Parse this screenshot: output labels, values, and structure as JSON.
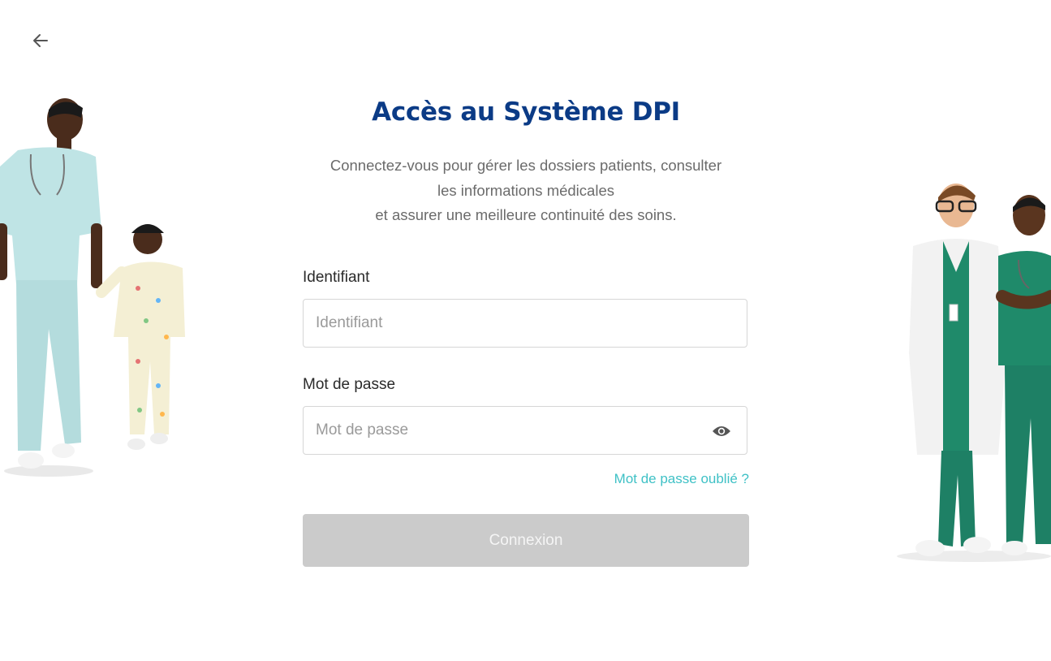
{
  "header": {
    "back_icon": "arrow-left-icon"
  },
  "login": {
    "title": "Accès au Système DPI",
    "subtitle_lines": [
      "Connectez-vous pour gérer les dossiers patients, consulter",
      "les informations médicales",
      "et assurer une meilleure continuité des soins."
    ],
    "username": {
      "label": "Identifiant",
      "placeholder": "Identifiant",
      "value": ""
    },
    "password": {
      "label": "Mot de passe",
      "placeholder": "Mot de passe",
      "value": "",
      "toggle_icon": "eye-icon"
    },
    "forgot_password": "Mot de passe oublié ?",
    "submit_label": "Connexion",
    "submit_disabled": true
  },
  "colors": {
    "title": "#0b3b86",
    "link": "#3fc1c6",
    "button_disabled": "#cbcbcb",
    "scrub_light": "#bfe4e5",
    "scrub_green": "#1f8a6a",
    "lab_coat": "#f2f2f2"
  },
  "illustrations": {
    "left": "nurse-with-child-illustration",
    "right": "doctors-group-illustration"
  }
}
